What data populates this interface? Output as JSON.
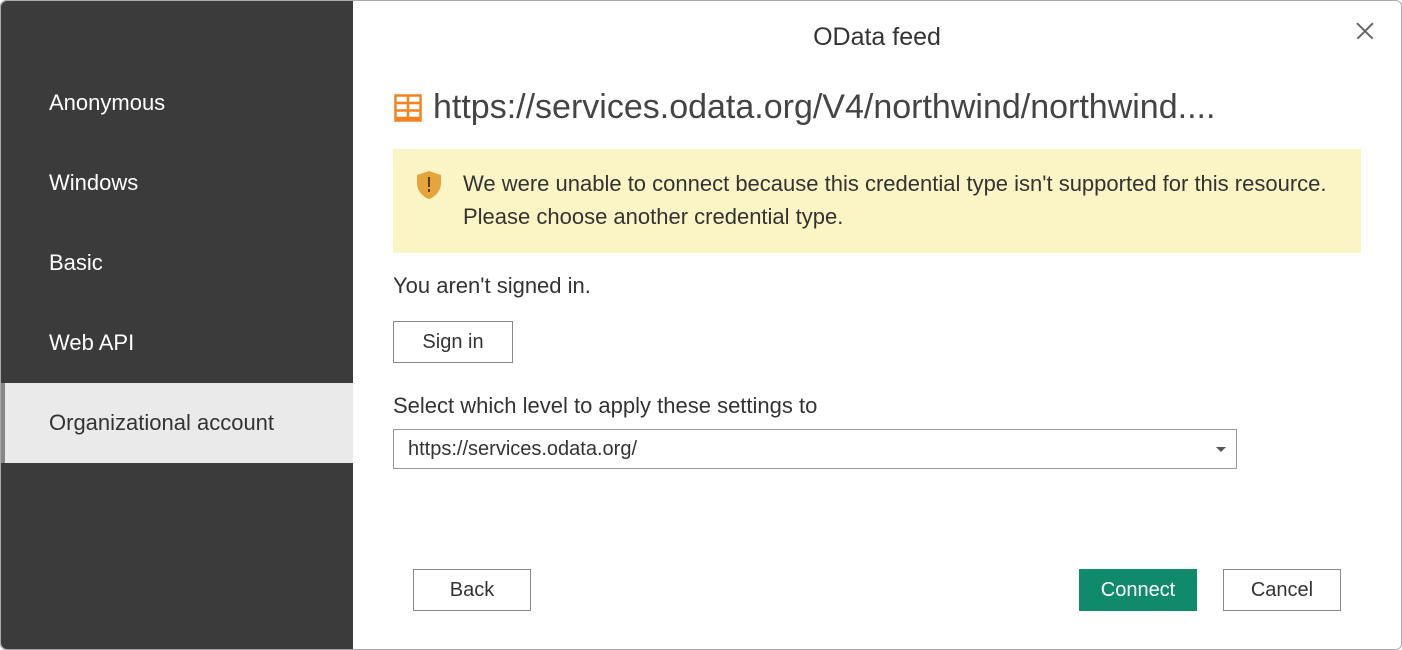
{
  "dialog": {
    "title": "OData feed",
    "url": "https://services.odata.org/V4/northwind/northwind....",
    "warning_message": "We were unable to connect because this credential type isn't supported for this resource. Please choose another credential type.",
    "signed_in_status": "You aren't signed in.",
    "sign_in_label": "Sign in",
    "level_label": "Select which level to apply these settings to",
    "level_value": "https://services.odata.org/",
    "footer": {
      "back_label": "Back",
      "connect_label": "Connect",
      "cancel_label": "Cancel"
    }
  },
  "sidebar": {
    "items": [
      {
        "label": "Anonymous"
      },
      {
        "label": "Windows"
      },
      {
        "label": "Basic"
      },
      {
        "label": "Web API"
      },
      {
        "label": "Organizational account"
      }
    ],
    "selected_index": 4
  },
  "colors": {
    "sidebar_bg": "#3b3b3b",
    "warning_bg": "#fbf4c5",
    "primary_button": "#0f8b6c",
    "shield": "#e6a43c",
    "odata_icon": "#f58220"
  }
}
